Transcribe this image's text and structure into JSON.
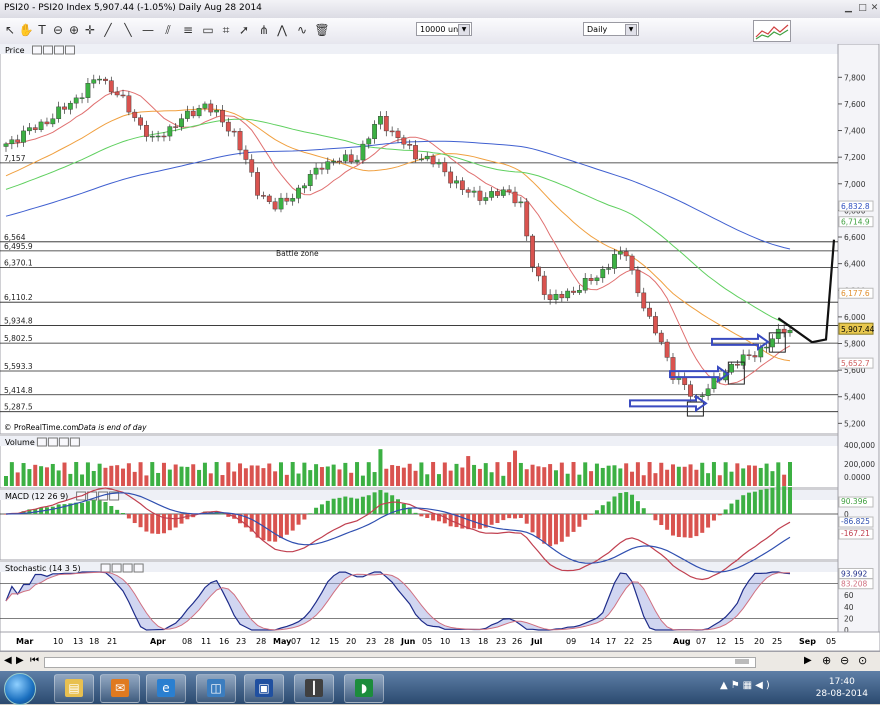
{
  "window": {
    "title": "PSI20 - PSI20 Index   5,907.44 (-1.05%)   Daily  Aug 28 2014"
  },
  "toolbar": {
    "units_value": "10000 units",
    "period_value": "Daily"
  },
  "price_pane": {
    "label": "Price",
    "last_price": "5,907.44",
    "copyright": "© ProRealTime.com",
    "eod_note": "Data is end of day",
    "annotation": "Battle zone",
    "levels": [
      {
        "label": "7,157",
        "value": 7157
      },
      {
        "label": "6,564",
        "value": 6564
      },
      {
        "label": "6,495.9",
        "value": 6495.9
      },
      {
        "label": "6,370.1",
        "value": 6370.1
      },
      {
        "label": "6,110.2",
        "value": 6110.2
      },
      {
        "label": "5,934.8",
        "value": 5934.8
      },
      {
        "label": "5,802.5",
        "value": 5802.5
      },
      {
        "label": "5,593.3",
        "value": 5593.3
      },
      {
        "label": "5,414.8",
        "value": 5414.8
      },
      {
        "label": "5,287.5",
        "value": 5287.5
      }
    ],
    "axis_ticks": [
      "7,800",
      "7,600",
      "7,400",
      "7,200",
      "7,000",
      "6,800",
      "6,600",
      "6,400",
      "6,200",
      "6,000",
      "5,800",
      "5,600",
      "5,400",
      "5,200"
    ],
    "ma_labels": [
      {
        "text": "6,832.8",
        "color": "#3050c0"
      },
      {
        "text": "6,714.9",
        "color": "#40a040"
      },
      {
        "text": "6,177.6",
        "color": "#e09030"
      },
      {
        "text": "5,652.7",
        "color": "#d06060"
      }
    ]
  },
  "volume_pane": {
    "label": "Volume",
    "ticks": [
      "400,000",
      "200,000",
      "0.0000"
    ]
  },
  "macd_pane": {
    "label": "MACD (12 26 9)",
    "ticks": [
      "0"
    ],
    "values": [
      "90.396",
      "-86.825",
      "-167.21"
    ]
  },
  "stoch_pane": {
    "label": "Stochastic (14 3 5)",
    "ticks": [
      "92",
      "80",
      "60",
      "40",
      "20",
      "0"
    ],
    "values": [
      "93.992",
      "83.208"
    ]
  },
  "x_axis": {
    "labels": [
      "Mar",
      "10",
      "13",
      "18",
      "21",
      "Apr",
      "08",
      "11",
      "16",
      "23",
      "28",
      "May",
      "07",
      "12",
      "15",
      "20",
      "23",
      "28",
      "Jun",
      "05",
      "10",
      "13",
      "18",
      "23",
      "26",
      "Jul",
      "09",
      "14",
      "17",
      "22",
      "25",
      "Aug",
      "07",
      "12",
      "15",
      "20",
      "25",
      "Sep",
      "05"
    ]
  },
  "taskbar": {
    "time": "17:40",
    "date": "28-08-2014"
  },
  "colors": {
    "up_candle": "#3cb043",
    "down_candle": "#d9534f",
    "arrow": "#3a4bc0",
    "ma_red": "#e07070",
    "ma_orange": "#f0a040",
    "ma_green": "#60d060",
    "ma_blue": "#4060d0",
    "ochre": "#e8c850"
  }
}
